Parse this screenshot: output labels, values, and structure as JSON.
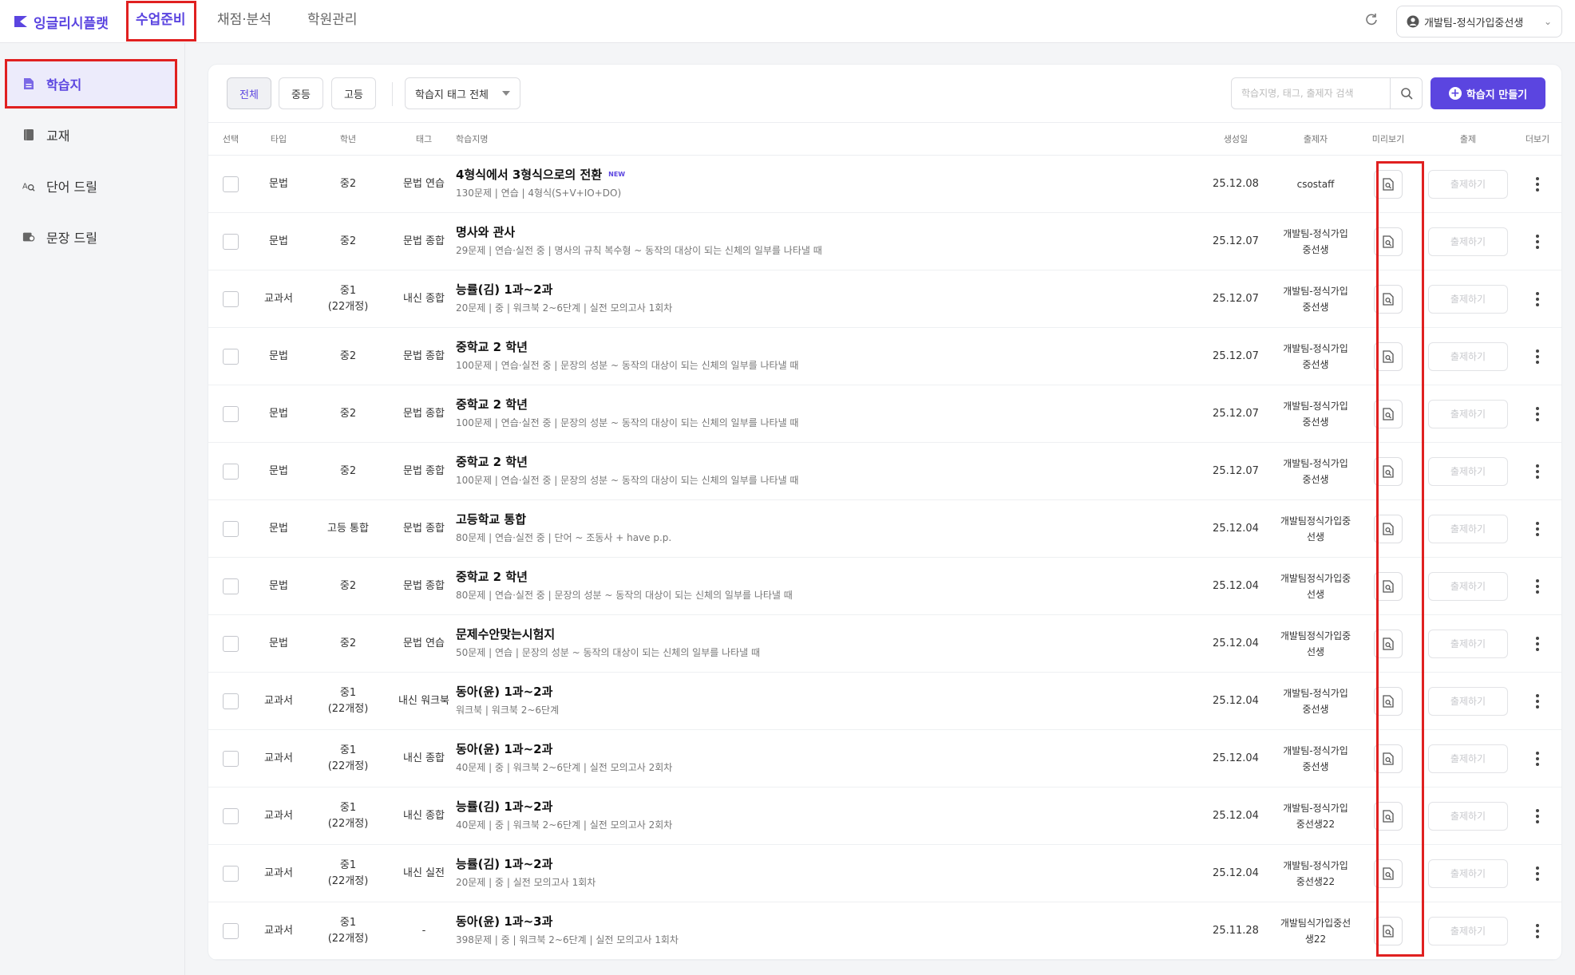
{
  "brand": {
    "name": "잉글리시플랫",
    "color": "#5b45e0"
  },
  "nav": {
    "tabs": [
      {
        "label": "수업준비",
        "active": true
      },
      {
        "label": "채점·분석",
        "active": false
      },
      {
        "label": "학원관리",
        "active": false
      }
    ]
  },
  "header": {
    "refresh_icon": "refresh-icon",
    "user_name": "개발팀-정식가입중선생"
  },
  "sidebar": {
    "items": [
      {
        "label": "학습지",
        "icon": "document-icon",
        "active": true
      },
      {
        "label": "교재",
        "icon": "book-icon",
        "active": false
      },
      {
        "label": "단어 드릴",
        "icon": "word-drill-icon",
        "active": false
      },
      {
        "label": "문장 드릴",
        "icon": "sentence-drill-icon",
        "active": false
      }
    ]
  },
  "filters": {
    "levels": [
      "전체",
      "중등",
      "고등"
    ],
    "tag_select": "학습지 태그 전체",
    "search_placeholder": "학습지명, 태그, 출제자 검색",
    "create_label": "학습지 만들기"
  },
  "table": {
    "headers": {
      "select": "선택",
      "type": "타입",
      "grade": "학년",
      "tag": "태그",
      "name": "학습지명",
      "date": "생성일",
      "author": "출제자",
      "preview": "미리보기",
      "assign": "출제",
      "more": "더보기"
    },
    "assign_label": "출제하기",
    "rows": [
      {
        "type": "문법",
        "grade": "중2",
        "tag": "문법 연습",
        "title": "4형식에서 3형식으로의 전환",
        "is_new": "NEW",
        "subtitle": "130문제 | 연습 | 4형식(S+V+IO+DO)",
        "date": "25.12.08",
        "author": "csostaff"
      },
      {
        "type": "문법",
        "grade": "중2",
        "tag": "문법 종합",
        "title": "명사와 관사",
        "is_new": "",
        "subtitle": "29문제 | 연습·실전 중 | 명사의 규칙 복수형 ~ 동작의 대상이 되는 신체의 일부를 나타낼 때",
        "date": "25.12.07",
        "author": "개발팀-정식가입\n중선생"
      },
      {
        "type": "교과서",
        "grade": "중1\n(22개정)",
        "tag": "내신 종합",
        "title": "능률(김) 1과~2과",
        "is_new": "",
        "subtitle": "20문제 | 중 | 워크북 2~6단계 | 실전 모의고사 1회차",
        "date": "25.12.07",
        "author": "개발팀-정식가입\n중선생"
      },
      {
        "type": "문법",
        "grade": "중2",
        "tag": "문법 종합",
        "title": "중학교 2 학년",
        "is_new": "",
        "subtitle": "100문제 | 연습·실전 중 | 문장의 성분 ~ 동작의 대상이 되는 신체의 일부를 나타낼 때",
        "date": "25.12.07",
        "author": "개발팀-정식가입\n중선생"
      },
      {
        "type": "문법",
        "grade": "중2",
        "tag": "문법 종합",
        "title": "중학교 2 학년",
        "is_new": "",
        "subtitle": "100문제 | 연습·실전 중 | 문장의 성분 ~ 동작의 대상이 되는 신체의 일부를 나타낼 때",
        "date": "25.12.07",
        "author": "개발팀-정식가입\n중선생"
      },
      {
        "type": "문법",
        "grade": "중2",
        "tag": "문법 종합",
        "title": "중학교 2 학년",
        "is_new": "",
        "subtitle": "100문제 | 연습·실전 중 | 문장의 성분 ~ 동작의 대상이 되는 신체의 일부를 나타낼 때",
        "date": "25.12.07",
        "author": "개발팀-정식가입\n중선생"
      },
      {
        "type": "문법",
        "grade": "고등 통합",
        "tag": "문법 종합",
        "title": "고등학교 통합",
        "is_new": "",
        "subtitle": "80문제 | 연습·실전 중 | 단어 ~ 조동사 + have p.p.",
        "date": "25.12.04",
        "author": "개발팀정식가입중\n선생"
      },
      {
        "type": "문법",
        "grade": "중2",
        "tag": "문법 종합",
        "title": "중학교 2 학년",
        "is_new": "",
        "subtitle": "80문제 | 연습·실전 중 | 문장의 성분 ~ 동작의 대상이 되는 신체의 일부를 나타낼 때",
        "date": "25.12.04",
        "author": "개발팀정식가입중\n선생"
      },
      {
        "type": "문법",
        "grade": "중2",
        "tag": "문법 연습",
        "title": "문제수안맞는시험지",
        "is_new": "",
        "subtitle": "50문제 | 연습 | 문장의 성분 ~ 동작의 대상이 되는 신체의 일부를 나타낼 때",
        "date": "25.12.04",
        "author": "개발팀정식가입중\n선생"
      },
      {
        "type": "교과서",
        "grade": "중1\n(22개정)",
        "tag": "내신 워크북",
        "title": "동아(윤) 1과~2과",
        "is_new": "",
        "subtitle": "워크북 | 워크북 2~6단계",
        "date": "25.12.04",
        "author": "개발팀-정식가입\n중선생"
      },
      {
        "type": "교과서",
        "grade": "중1\n(22개정)",
        "tag": "내신 종합",
        "title": "동아(윤) 1과~2과",
        "is_new": "",
        "subtitle": "40문제 | 중 | 워크북 2~6단계 | 실전 모의고사 2회차",
        "date": "25.12.04",
        "author": "개발팀-정식가입\n중선생"
      },
      {
        "type": "교과서",
        "grade": "중1\n(22개정)",
        "tag": "내신 종합",
        "title": "능률(김) 1과~2과",
        "is_new": "",
        "subtitle": "40문제 | 중 | 워크북 2~6단계 | 실전 모의고사 2회차",
        "date": "25.12.04",
        "author": "개발팀-정식가입\n중선생22"
      },
      {
        "type": "교과서",
        "grade": "중1\n(22개정)",
        "tag": "내신 실전",
        "title": "능률(김) 1과~2과",
        "is_new": "",
        "subtitle": "20문제 | 중 | 실전 모의고사 1회차",
        "date": "25.12.04",
        "author": "개발팀-정식가입\n중선생22"
      },
      {
        "type": "교과서",
        "grade": "중1\n(22개정)",
        "tag": "-",
        "title": "동아(윤) 1과~3과",
        "is_new": "",
        "subtitle": "398문제 | 중 | 워크북 2~6단계 | 실전 모의고사 1회차",
        "date": "25.11.28",
        "author": "개발팀식가입중선\n생22"
      }
    ]
  }
}
